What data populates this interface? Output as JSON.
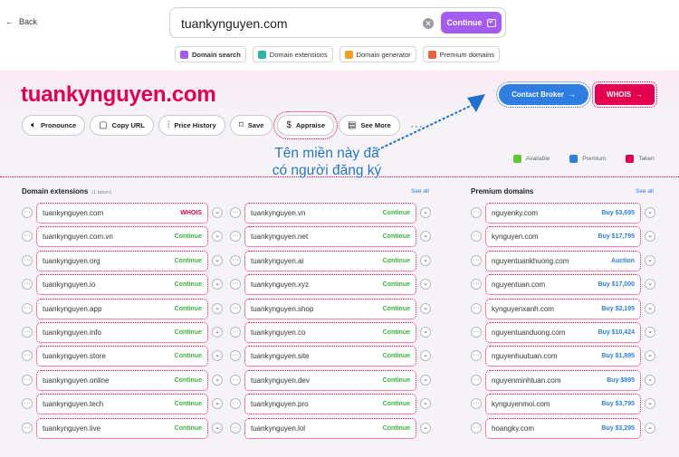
{
  "nav": {
    "back_label": "Back"
  },
  "search": {
    "value": "tuankynguyen.com",
    "continue_label": "Continue"
  },
  "tools": [
    {
      "label": "Domain search",
      "color": "#a45cf0",
      "active": true
    },
    {
      "label": "Domain extensions",
      "color": "#2bb5a4",
      "active": false
    },
    {
      "label": "Domain generator",
      "color": "#f0a020",
      "active": false
    },
    {
      "label": "Premium domains",
      "color": "#e8603c",
      "active": false
    }
  ],
  "domain": {
    "name": "tuankynguyen.com"
  },
  "buttons": {
    "contact_broker": "Contact Broker",
    "whois": "WHOIS"
  },
  "actions": [
    {
      "label": "Pronounce",
      "icon": "speaker-icon"
    },
    {
      "label": "Copy URL",
      "icon": "clipboard-icon"
    },
    {
      "label": "Price History",
      "icon": "chart-icon"
    },
    {
      "label": "Save",
      "icon": "bookmark-icon"
    },
    {
      "label": "Appraise",
      "icon": "dollar-icon"
    },
    {
      "label": "See More",
      "icon": "document-icon"
    }
  ],
  "legend": [
    {
      "label": "Available",
      "color": "#5cc832"
    },
    {
      "label": "Premium",
      "color": "#2d7ee0"
    },
    {
      "label": "Taken",
      "color": "#e5004f"
    }
  ],
  "annotation": {
    "line1": "Tên miền này đã",
    "line2": "có người đăng ký"
  },
  "extensions": {
    "title": "Domain extensions",
    "sub": "(1 taken)",
    "see_all": "See all",
    "col1": [
      {
        "name": "tuankynguyen.com",
        "status": "WHOIS",
        "kind": "taken"
      },
      {
        "name": "tuankynguyen.com.vn",
        "status": "Continue",
        "kind": "cont"
      },
      {
        "name": "tuankynguyen.org",
        "status": "Continue",
        "kind": "cont"
      },
      {
        "name": "tuankynguyen.io",
        "status": "Continue",
        "kind": "cont"
      },
      {
        "name": "tuankynguyen.app",
        "status": "Continue",
        "kind": "cont"
      },
      {
        "name": "tuankynguyen.info",
        "status": "Continue",
        "kind": "cont"
      },
      {
        "name": "tuankynguyen.store",
        "status": "Continue",
        "kind": "cont"
      },
      {
        "name": "tuankynguyen.online",
        "status": "Continue",
        "kind": "cont"
      },
      {
        "name": "tuankynguyen.tech",
        "status": "Continue",
        "kind": "cont"
      },
      {
        "name": "tuankynguyen.live",
        "status": "Continue",
        "kind": "cont"
      }
    ],
    "col2": [
      {
        "name": "tuankynguyen.vn",
        "status": "Continue",
        "kind": "cont"
      },
      {
        "name": "tuankynguyen.net",
        "status": "Continue",
        "kind": "cont"
      },
      {
        "name": "tuankynguyen.ai",
        "status": "Continue",
        "kind": "cont"
      },
      {
        "name": "tuankynguyen.xyz",
        "status": "Continue",
        "kind": "cont"
      },
      {
        "name": "tuankynguyen.shop",
        "status": "Continue",
        "kind": "cont"
      },
      {
        "name": "tuankynguyen.co",
        "status": "Continue",
        "kind": "cont"
      },
      {
        "name": "tuankynguyen.site",
        "status": "Continue",
        "kind": "cont"
      },
      {
        "name": "tuankynguyen.dev",
        "status": "Continue",
        "kind": "cont"
      },
      {
        "name": "tuankynguyen.pro",
        "status": "Continue",
        "kind": "cont"
      },
      {
        "name": "tuankynguyen.lol",
        "status": "Continue",
        "kind": "cont"
      }
    ]
  },
  "premium": {
    "title": "Premium domains",
    "see_all": "See all",
    "items": [
      {
        "name": "nguyenky.com",
        "status": "Buy $3,695"
      },
      {
        "name": "kynguyen.com",
        "status": "Buy $17,795"
      },
      {
        "name": "nguyentuankhuong.com",
        "status": "Auction"
      },
      {
        "name": "nguyentuan.com",
        "status": "Buy $17,000"
      },
      {
        "name": "kynguyenxanh.com",
        "status": "Buy $2,195"
      },
      {
        "name": "nguyentuanduong.com",
        "status": "Buy $10,424"
      },
      {
        "name": "nguyenhuutuan.com",
        "status": "Buy $1,895"
      },
      {
        "name": "nguyenminhtuan.com",
        "status": "Buy $895"
      },
      {
        "name": "kynguyenmoi.com",
        "status": "Buy $3,795"
      },
      {
        "name": "hoangky.com",
        "status": "Buy $3,295"
      }
    ]
  }
}
